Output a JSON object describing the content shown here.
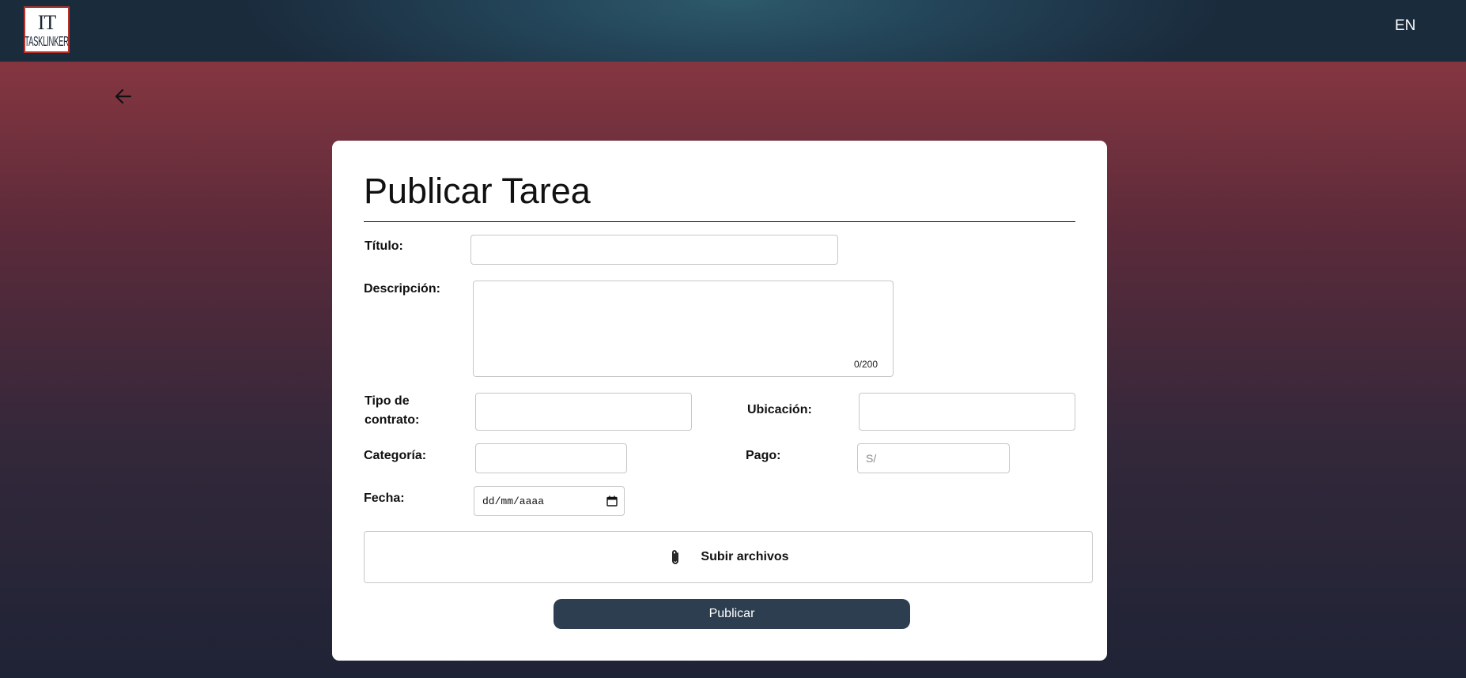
{
  "header": {
    "logo_mark": "IT",
    "logo_text": "TASKLINKER",
    "language_toggle": "EN"
  },
  "form": {
    "title": "Publicar Tarea",
    "fields": {
      "titulo": {
        "label": "Título:",
        "value": ""
      },
      "descripcion": {
        "label": "Descripción:",
        "value": "",
        "counter": "0/200"
      },
      "tipo_contrato": {
        "label": "Tipo de contrato:",
        "value": ""
      },
      "ubicacion": {
        "label": "Ubicación:",
        "value": ""
      },
      "categoria": {
        "label": "Categoría:",
        "value": ""
      },
      "pago": {
        "label": "Pago:",
        "value": "",
        "placeholder": "S/"
      },
      "fecha": {
        "label": "Fecha:",
        "placeholder": "dd/mm/aaaa"
      }
    },
    "upload_label": "Subir archivos",
    "submit_label": "Publicar"
  },
  "icons": {
    "back": "arrow-left-icon",
    "upload": "paperclip-icon",
    "calendar": "calendar-icon"
  }
}
